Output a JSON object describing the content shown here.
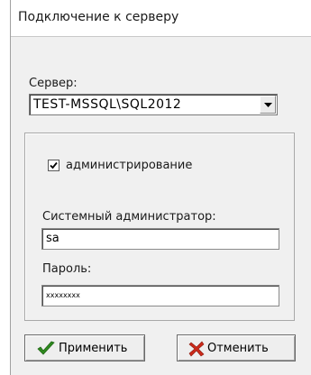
{
  "window": {
    "title": "Подключение к серверу"
  },
  "server": {
    "label": "Сервер:",
    "value": "TEST-MSSQL\\SQL2012"
  },
  "admin": {
    "checkbox_label": "администрирование",
    "checked": true,
    "sysadmin_label": "Системный администратор:",
    "sysadmin_value": "sa",
    "password_label": "Пароль:",
    "password_value": "xxxxxxxx"
  },
  "buttons": {
    "apply": "Применить",
    "cancel": "Отменить"
  },
  "colors": {
    "apply_icon": "#2e8b1e",
    "cancel_icon": "#cc2a1a"
  },
  "icons": {
    "apply": "checkmark-icon",
    "cancel": "cross-icon",
    "dropdown": "chevron-down-icon"
  }
}
